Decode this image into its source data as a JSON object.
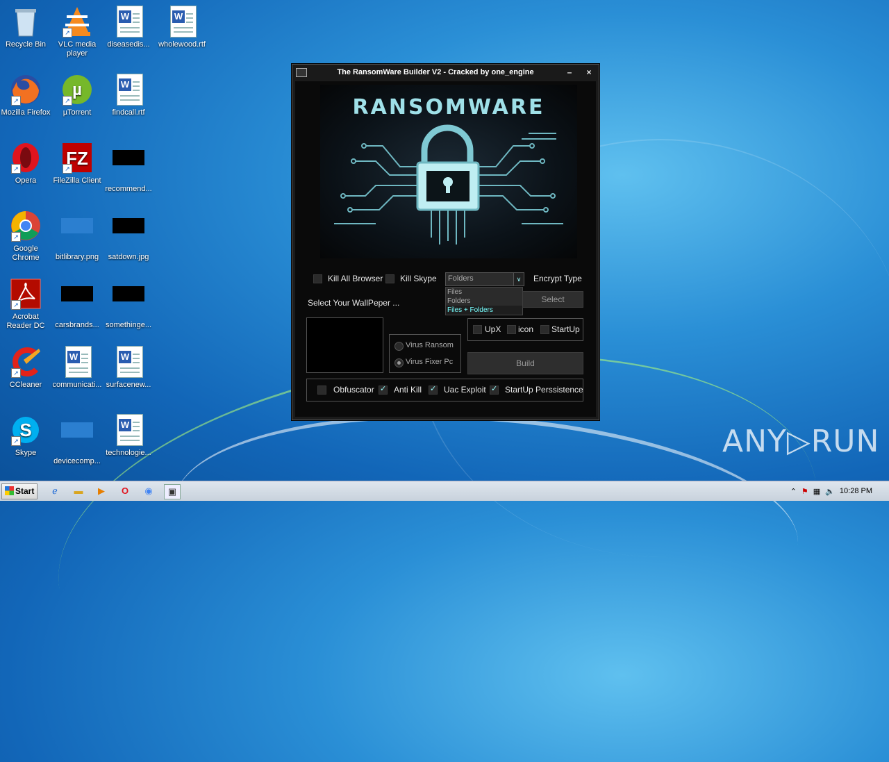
{
  "desktop_icons": [
    {
      "label": "Recycle Bin",
      "icon": "recycle-bin-icon"
    },
    {
      "label": "VLC media player",
      "icon": "vlc-icon"
    },
    {
      "label": "diseasedis...",
      "icon": "word-doc-icon"
    },
    {
      "label": "wholewood.rtf",
      "icon": "word-doc-icon"
    },
    {
      "label": "Mozilla Firefox",
      "icon": "firefox-icon"
    },
    {
      "label": "µTorrent",
      "icon": "utorrent-icon"
    },
    {
      "label": "findcall.rtf",
      "icon": "word-doc-icon"
    },
    {
      "label": "Opera",
      "icon": "opera-icon"
    },
    {
      "label": "FileZilla Client",
      "icon": "filezilla-icon"
    },
    {
      "label": "recommend...",
      "icon": "image-thumb-icon"
    },
    {
      "label": "Google Chrome",
      "icon": "chrome-icon"
    },
    {
      "label": "bitlibrary.png",
      "icon": "image-thumb-icon"
    },
    {
      "label": "satdown.jpg",
      "icon": "image-thumb-icon"
    },
    {
      "label": "Acrobat Reader DC",
      "icon": "acrobat-icon"
    },
    {
      "label": "carsbrands...",
      "icon": "image-thumb-icon"
    },
    {
      "label": "somethinge...",
      "icon": "image-thumb-icon"
    },
    {
      "label": "CCleaner",
      "icon": "ccleaner-icon"
    },
    {
      "label": "communicati...",
      "icon": "word-doc-icon"
    },
    {
      "label": "surfacenew...",
      "icon": "word-doc-icon"
    },
    {
      "label": "Skype",
      "icon": "skype-icon"
    },
    {
      "label": "devicecomp...",
      "icon": "image-thumb-icon"
    },
    {
      "label": "technologie...",
      "icon": "word-doc-icon"
    }
  ],
  "window": {
    "title": "The RansomWare Builder V2 - Cracked by one_engine",
    "minimize": "–",
    "close": "×",
    "banner_text": "RANSOMWARE",
    "kill_all_browser": "Kill All Browser",
    "kill_skype": "Kill Skype",
    "encrypt_type_label": "Encrypt Type",
    "encrypt_selected": "Folders",
    "encrypt_options": [
      "Files",
      "Folders",
      "Files + Folders"
    ],
    "wallpaper_label": "Select Your WallPeper ...",
    "select_button": "Select",
    "virus_ransom": "Virus Ransom",
    "virus_fixer": "Virus Fixer Pc",
    "upx": "UpX",
    "icon": "icon",
    "startup": "StartUp",
    "build_button": "Build",
    "obfuscator": "Obfuscator",
    "anti_kill": "Anti Kill",
    "uac_exploit": "Uac Exploit",
    "startup_persistence": "StartUp Perssistence",
    "checked": {
      "anti_kill": true,
      "uac_exploit": true,
      "startup_persistence": true,
      "obfuscator": false
    }
  },
  "taskbar": {
    "start_label": "Start",
    "clock": "10:28 PM"
  },
  "watermark": "ANY▷RUN"
}
